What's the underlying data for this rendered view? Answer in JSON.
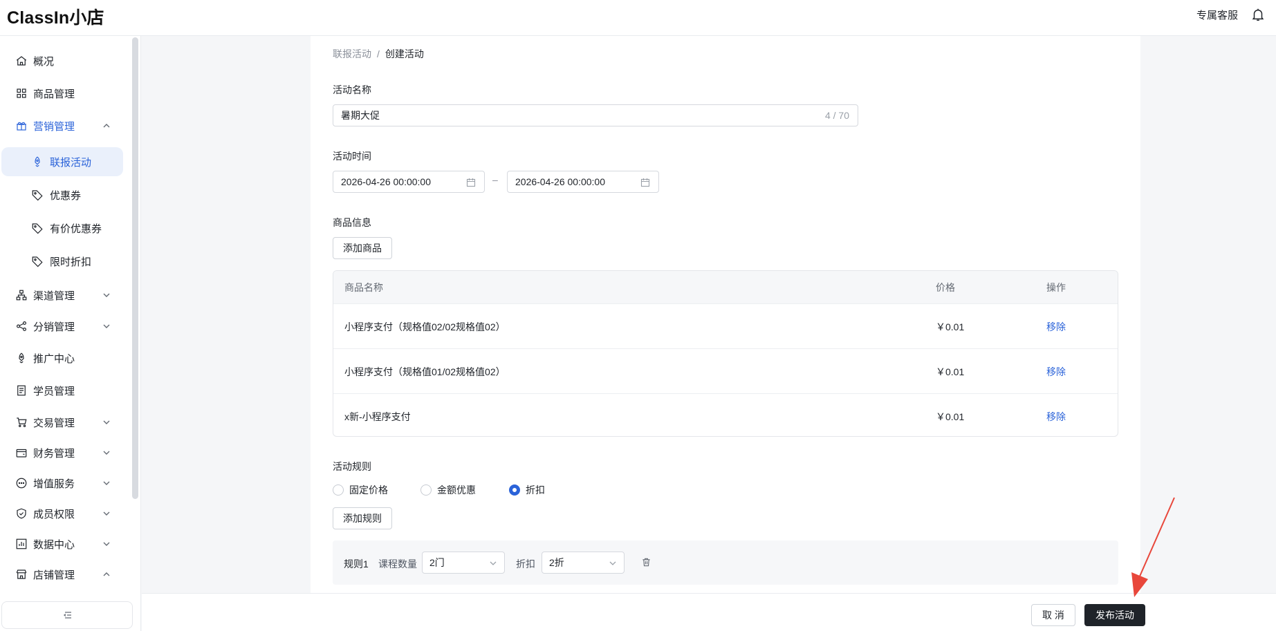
{
  "app": {
    "logo": "ClassIn小店",
    "support": "专属客服"
  },
  "sidebar": {
    "items": [
      {
        "label": "概况",
        "icon": "home-icon"
      },
      {
        "label": "商品管理",
        "icon": "grid-icon"
      },
      {
        "label": "营销管理",
        "icon": "gift-icon",
        "expanded": true
      },
      {
        "label": "联报活动",
        "icon": "rocket-icon",
        "active": true
      },
      {
        "label": "优惠券",
        "icon": "tag-icon"
      },
      {
        "label": "有价优惠券",
        "icon": "tag-icon"
      },
      {
        "label": "限时折扣",
        "icon": "tag-icon"
      },
      {
        "label": "渠道管理",
        "icon": "sitemap-icon"
      },
      {
        "label": "分销管理",
        "icon": "share-icon"
      },
      {
        "label": "推广中心",
        "icon": "rocket-icon"
      },
      {
        "label": "学员管理",
        "icon": "document-icon"
      },
      {
        "label": "交易管理",
        "icon": "cart-icon"
      },
      {
        "label": "财务管理",
        "icon": "wallet-icon"
      },
      {
        "label": "增值服务",
        "icon": "chat-icon"
      },
      {
        "label": "成员权限",
        "icon": "shield-icon"
      },
      {
        "label": "数据中心",
        "icon": "bar-chart-icon"
      },
      {
        "label": "店铺管理",
        "icon": "store-icon",
        "expanded": true
      }
    ]
  },
  "breadcrumb": {
    "parent": "联报活动",
    "separator": "/",
    "current": "创建活动"
  },
  "form": {
    "name_label": "活动名称",
    "name_value": "暑期大促",
    "name_count": "4 / 70",
    "time_label": "活动时间",
    "start_time": "2026-04-26 00:00:00",
    "end_time": "2026-04-26 00:00:00",
    "time_sep": "–",
    "goods_label": "商品信息",
    "add_goods": "添加商品",
    "rules_label": "活动规则",
    "rule_options": [
      "固定价格",
      "金额优惠",
      "折扣"
    ],
    "rule_selected": "折扣",
    "add_rule": "添加规则"
  },
  "table": {
    "headers": {
      "name": "商品名称",
      "price": "价格",
      "action": "操作"
    },
    "rows": [
      {
        "name": "小程序支付（规格值02/02规格值02）",
        "price": "￥0.01",
        "action": "移除"
      },
      {
        "name": "小程序支付（规格值01/02规格值02）",
        "price": "￥0.01",
        "action": "移除"
      },
      {
        "name": "x新-小程序支付",
        "price": "￥0.01",
        "action": "移除"
      }
    ]
  },
  "rule1": {
    "title": "规则1",
    "count_label": "课程数量",
    "count_value": "2门",
    "discount_label": "折扣",
    "discount_value": "2折"
  },
  "footer": {
    "cancel": "取 消",
    "publish": "发布活动"
  },
  "colors": {
    "accent": "#2b63d9",
    "primary_button": "#1f2329",
    "annotation": "#e8473b"
  }
}
